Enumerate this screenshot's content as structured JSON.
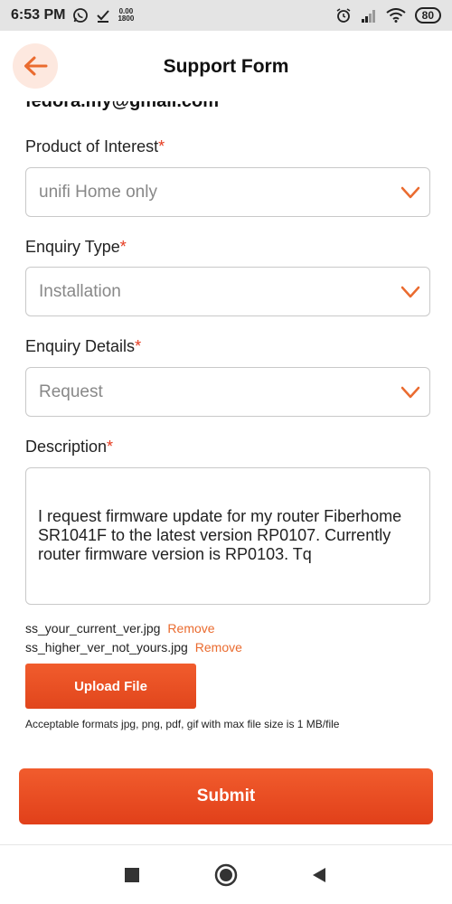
{
  "status_bar": {
    "time": "6:53 PM",
    "speed_top": "0.00",
    "speed_bottom": "1800",
    "battery": "80"
  },
  "header": {
    "title": "Support Form"
  },
  "form": {
    "email_partial": "fedora.my@gmail.com",
    "product": {
      "label": "Product of Interest",
      "required": "*",
      "value": "unifi Home only"
    },
    "enquiry_type": {
      "label": "Enquiry Type",
      "required": "*",
      "value": "Installation"
    },
    "enquiry_details": {
      "label": "Enquiry Details",
      "required": "*",
      "value": "Request"
    },
    "description": {
      "label": "Description",
      "required": "*",
      "value": "I request firmware update for my router Fiberhome SR1041F to the latest version RP0107. Currently router firmware version is RP0103. Tq"
    },
    "files": [
      {
        "name": "ss_your_current_ver.jpg",
        "action": "Remove"
      },
      {
        "name": "ss_higher_ver_not_yours.jpg",
        "action": "Remove"
      }
    ],
    "upload_label": "Upload File",
    "formats_note": "Acceptable formats jpg, png, pdf, gif with max file size is 1 MB/file",
    "submit_label": "Submit"
  },
  "colors": {
    "accent": "#ea6b2f",
    "button": "#e9502a",
    "required": "#e53a1f"
  },
  "icons": {
    "back": "arrow-left-icon",
    "chevron": "chevron-down-icon",
    "nav_recents": "square-icon",
    "nav_home": "circle-icon",
    "nav_back": "triangle-icon"
  }
}
